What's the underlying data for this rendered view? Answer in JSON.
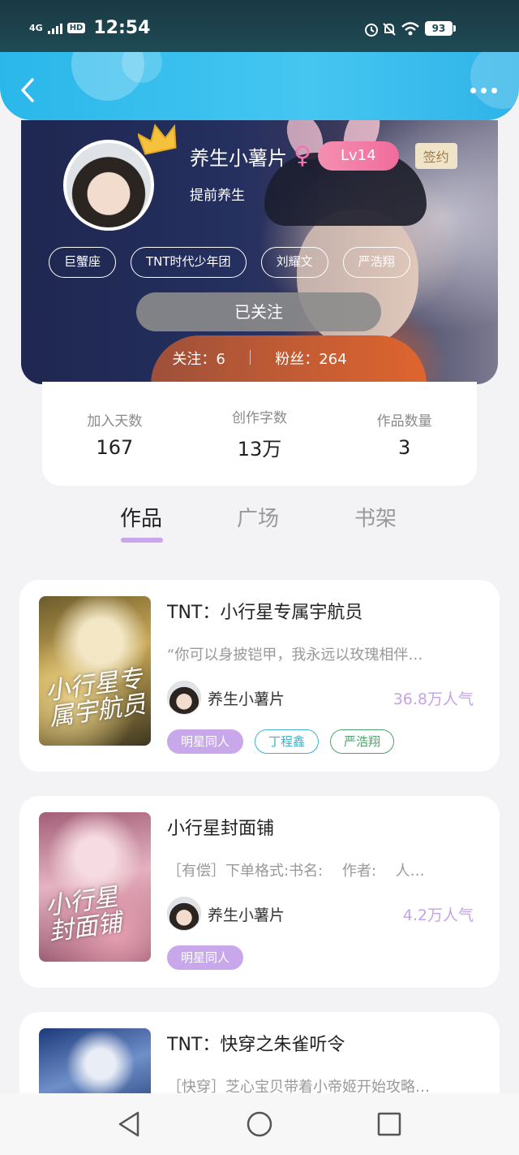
{
  "status_bar": {
    "network": "4G",
    "hd": "HD",
    "time": "12:54",
    "battery": "93"
  },
  "header": {
    "back_icon": "chevron-left-icon",
    "more_icon": "more-dots-icon"
  },
  "profile": {
    "nickname": "养生小薯片",
    "gender_symbol": "♀",
    "level": "Lv14",
    "sign_badge": "签约",
    "motto": "提前养生",
    "tags": [
      "巨蟹座",
      "TNT时代少年团",
      "刘耀文",
      "严浩翔"
    ],
    "follow_button": "已关注",
    "following": "关注：6",
    "fans": "粉丝：264"
  },
  "stats": [
    {
      "label": "加入天数",
      "value": "167"
    },
    {
      "label": "创作字数",
      "value": "13万"
    },
    {
      "label": "作品数量",
      "value": "3"
    }
  ],
  "tabs": [
    {
      "label": "作品",
      "active": true
    },
    {
      "label": "广场",
      "active": false
    },
    {
      "label": "书架",
      "active": false
    }
  ],
  "books": [
    {
      "title": "TNT：小行星专属宇航员",
      "desc": "“你可以身披铠甲，我永远以玫瑰相伴…",
      "author": "养生小薯片",
      "popularity": "36.8万人气",
      "cover_text": "小行星专属宇航员",
      "tags": [
        {
          "label": "明星同人",
          "style": "purple"
        },
        {
          "label": "丁程鑫",
          "style": "blue"
        },
        {
          "label": "严浩翔",
          "style": "green"
        }
      ]
    },
    {
      "title": "小行星封面铺",
      "desc": "［有偿］下单格式:书名:　 作者:　 人…",
      "author": "养生小薯片",
      "popularity": "4.2万人气",
      "cover_text": "小行星封面铺",
      "tags": [
        {
          "label": "明星同人",
          "style": "purple"
        }
      ]
    },
    {
      "title": "TNT：快穿之朱雀听令",
      "desc": "［快穿］芝心宝贝带着小帝姬开始攻略…",
      "author": "",
      "popularity": "",
      "cover_text": "",
      "tags": []
    }
  ],
  "nav": {
    "back": "nav-back-icon",
    "home": "nav-home-icon",
    "recents": "nav-recents-icon"
  },
  "colors": {
    "header": "#2ab7ea",
    "accent_purple": "#c8a8ea",
    "level_pink": "#f06c9b"
  }
}
